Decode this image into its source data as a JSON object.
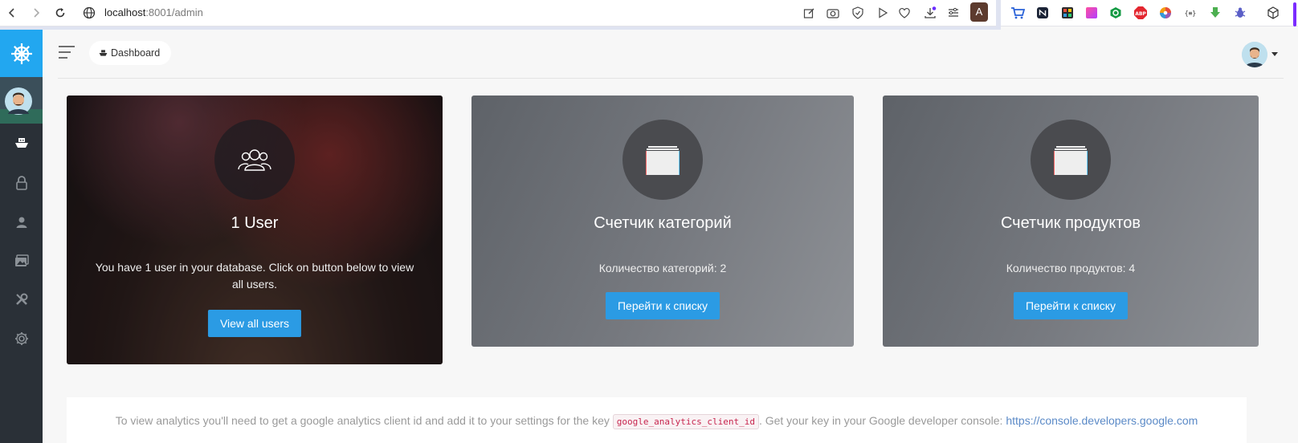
{
  "browser": {
    "url_host": "localhost",
    "url_path": ":8001/admin",
    "profile_initial": "A"
  },
  "breadcrumb": {
    "label": "Dashboard"
  },
  "cards": [
    {
      "title": "1 User",
      "text": "You have 1 user in your database. Click on button below to view all users.",
      "button": "View all users"
    },
    {
      "title": "Счетчик категорий",
      "text": "Количество категорий: 2",
      "button": "Перейти к списку"
    },
    {
      "title": "Счетчик продуктов",
      "text": "Количество продуктов: 4",
      "button": "Перейти к списку"
    }
  ],
  "notice": {
    "before": "To view analytics you'll need to get a google analytics client id and add it to your settings for the key",
    "key": "google_analytics_client_id",
    "middle": ". Get your key in your Google developer console:",
    "link": "https://console.developers.google.com"
  },
  "colors": {
    "accent": "#22a7f0",
    "button": "#2b9be4",
    "sidebar": "#2a3037"
  }
}
